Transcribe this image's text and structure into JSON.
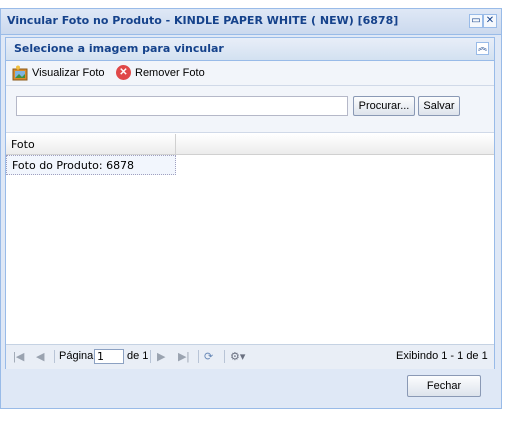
{
  "window": {
    "title": "Vincular Foto no Produto - KINDLE PAPER WHITE ( NEW) [6878]"
  },
  "panel": {
    "title": "Selecione a imagem para vincular"
  },
  "toolbar": {
    "view_label": "Visualizar Foto",
    "remove_label": "Remover Foto"
  },
  "form": {
    "file_value": "",
    "browse_label": "Procurar...",
    "save_label": "Salvar"
  },
  "grid": {
    "columns": [
      "Foto"
    ],
    "rows": [
      {
        "foto": "Foto do Produto: 6878"
      }
    ]
  },
  "pager": {
    "page_label": "Página",
    "page_value": "1",
    "of_label": "de 1",
    "display_text": "Exibindo 1 - 1 de 1"
  },
  "footer": {
    "close_label": "Fechar"
  },
  "colors": {
    "accent": "#15428b",
    "border": "#99bbe8",
    "remove": "#e04848"
  }
}
